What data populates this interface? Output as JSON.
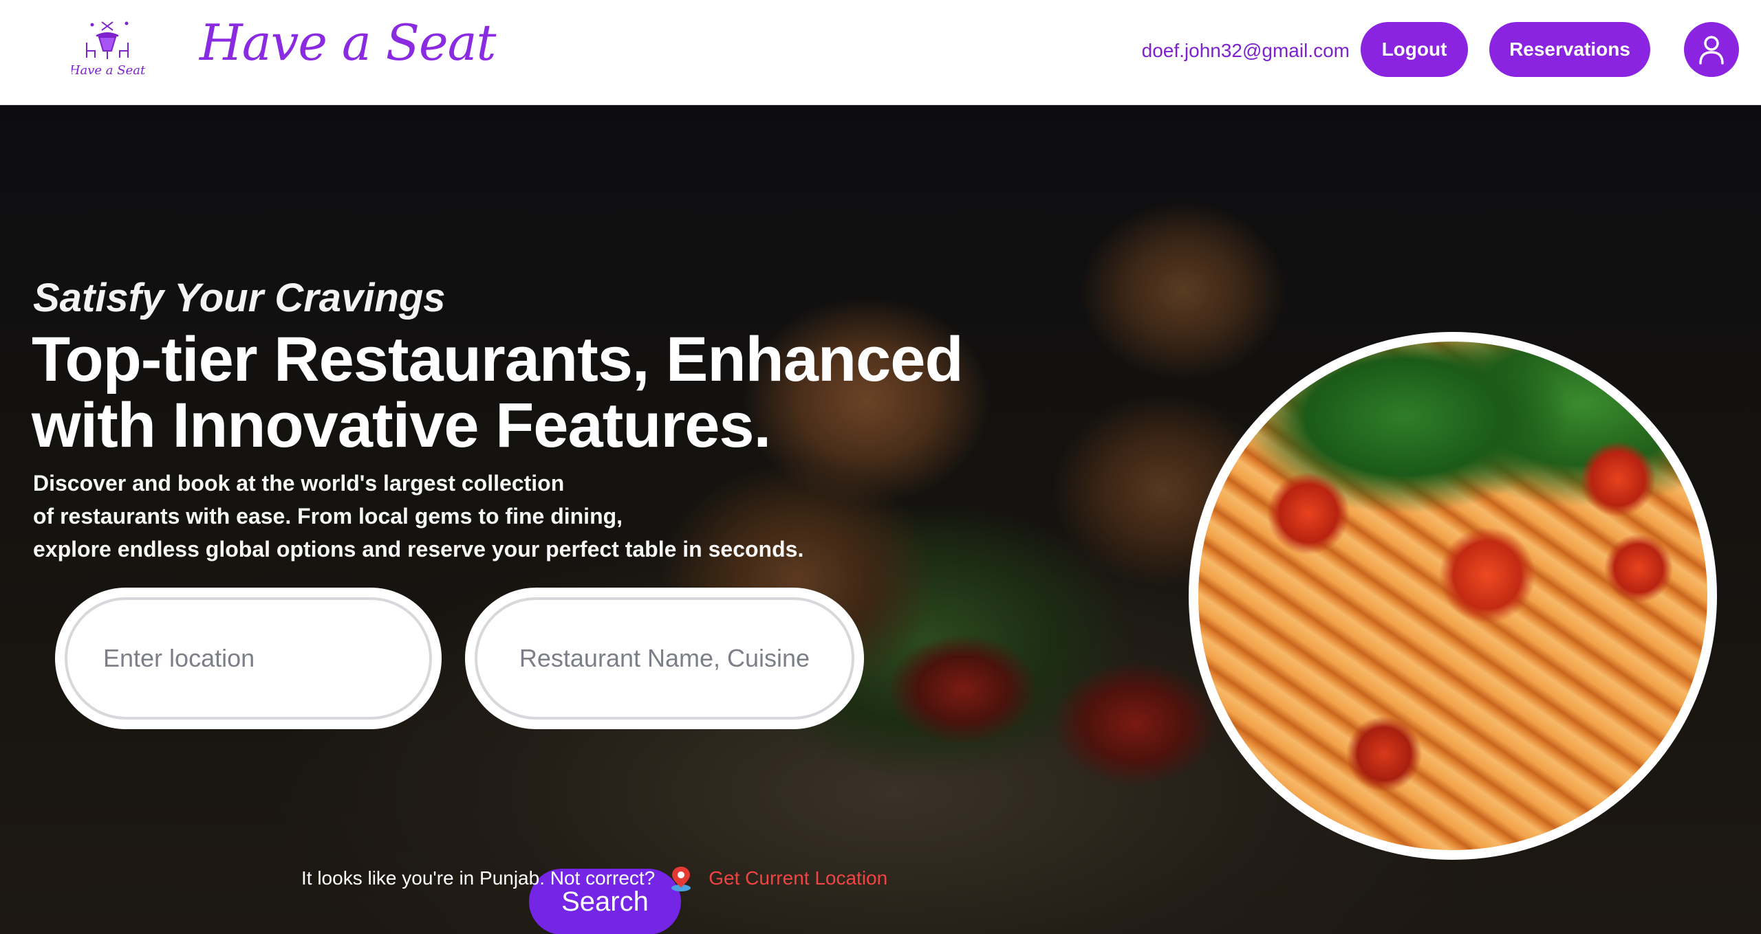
{
  "header": {
    "logo_text": "Have a Seat",
    "brand_name": "Have a Seat",
    "user_email": "doef.john32@gmail.com",
    "logout_label": "Logout",
    "reservations_label": "Reservations",
    "profile_icon": "user-icon",
    "colors": {
      "accent": "#8a24e0",
      "brand_text": "#8a2be2"
    }
  },
  "hero": {
    "tagline": "Satisfy Your Cravings",
    "title_line1": "Top-tier Restaurants, Enhanced",
    "title_line2": "with Innovative Features.",
    "description_line1": "Discover and book at the world's largest collection",
    "description_line2": "of restaurants with ease. From local gems to fine dining,",
    "description_line3": "explore endless global options and reserve your perfect table in seconds."
  },
  "search": {
    "location_value": "",
    "location_placeholder": "Enter location",
    "restaurant_value": "",
    "restaurant_placeholder": "Restaurant Name, Cuisine",
    "button_label": "Search",
    "button_color": "#7425e6"
  },
  "location_hint": {
    "text": "It looks like you're in Punjab. Not correct?",
    "icon": "map-pin-icon",
    "link_label": "Get Current Location",
    "link_color": "#ef4444"
  }
}
